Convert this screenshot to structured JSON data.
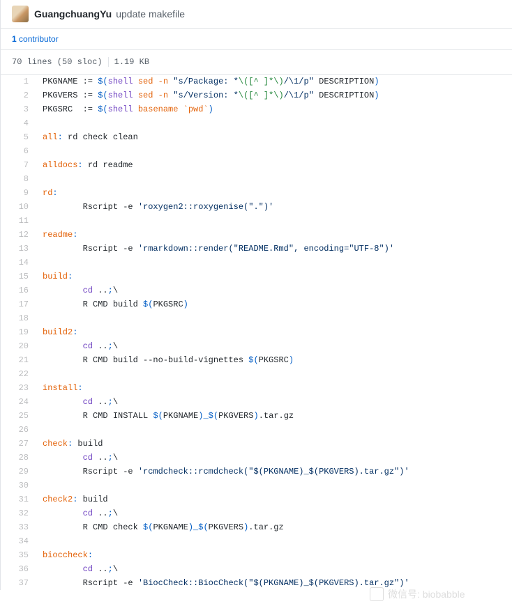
{
  "commit": {
    "author": "GuangchuangYu",
    "message": "update makefile"
  },
  "contributors": {
    "count": "1",
    "label": "contributor"
  },
  "file_meta": {
    "lines": "70 lines (50 sloc)",
    "size": "1.19 KB"
  },
  "code": [
    {
      "n": "1",
      "t": [
        [
          "",
          "PKGNAME := "
        ],
        [
          "k2",
          "$("
        ],
        [
          "k1",
          "shell"
        ],
        [
          "",
          " "
        ],
        [
          "kf",
          "sed -n "
        ],
        [
          "s1",
          "\"s/Package: *"
        ],
        [
          "gr",
          "\\([^ ]*\\)"
        ],
        [
          "s1",
          "/\\1/p\""
        ],
        [
          "",
          " DESCRIPTION"
        ],
        [
          "k2",
          ")"
        ]
      ]
    },
    {
      "n": "2",
      "t": [
        [
          "",
          "PKGVERS := "
        ],
        [
          "k2",
          "$("
        ],
        [
          "k1",
          "shell"
        ],
        [
          "",
          " "
        ],
        [
          "kf",
          "sed -n "
        ],
        [
          "s1",
          "\"s/Version: *"
        ],
        [
          "gr",
          "\\([^ ]*\\)"
        ],
        [
          "s1",
          "/\\1/p\""
        ],
        [
          "",
          " DESCRIPTION"
        ],
        [
          "k2",
          ")"
        ]
      ]
    },
    {
      "n": "3",
      "t": [
        [
          "",
          "PKGSRC  := "
        ],
        [
          "k2",
          "$("
        ],
        [
          "k1",
          "shell"
        ],
        [
          "",
          " "
        ],
        [
          "kf",
          "basename `pwd`"
        ],
        [
          "k2",
          ")"
        ]
      ]
    },
    {
      "n": "4",
      "t": []
    },
    {
      "n": "5",
      "t": [
        [
          "tg",
          "all"
        ],
        [
          "k2",
          ":"
        ],
        [
          "",
          " rd check clean"
        ]
      ]
    },
    {
      "n": "6",
      "t": []
    },
    {
      "n": "7",
      "t": [
        [
          "tg",
          "alldocs"
        ],
        [
          "k2",
          ":"
        ],
        [
          "",
          " rd readme"
        ]
      ]
    },
    {
      "n": "8",
      "t": []
    },
    {
      "n": "9",
      "t": [
        [
          "tg",
          "rd"
        ],
        [
          "k2",
          ":"
        ]
      ]
    },
    {
      "n": "10",
      "t": [
        [
          "",
          "        Rscript -e "
        ],
        [
          "s1",
          "'roxygen2::roxygenise(\".\")'"
        ]
      ]
    },
    {
      "n": "11",
      "t": []
    },
    {
      "n": "12",
      "t": [
        [
          "tg",
          "readme"
        ],
        [
          "k2",
          ":"
        ]
      ]
    },
    {
      "n": "13",
      "t": [
        [
          "",
          "        Rscript -e "
        ],
        [
          "s1",
          "'rmarkdown::render(\"README.Rmd\", encoding=\"UTF-8\")'"
        ]
      ]
    },
    {
      "n": "14",
      "t": []
    },
    {
      "n": "15",
      "t": [
        [
          "tg",
          "build"
        ],
        [
          "k2",
          ":"
        ]
      ]
    },
    {
      "n": "16",
      "t": [
        [
          "",
          "        "
        ],
        [
          "k1",
          "cd"
        ],
        [
          "",
          " .."
        ],
        [
          "k2",
          ";"
        ],
        [
          "",
          "\\"
        ]
      ]
    },
    {
      "n": "17",
      "t": [
        [
          "",
          "        R CMD build "
        ],
        [
          "k2",
          "$("
        ],
        [
          "",
          "PKGSRC"
        ],
        [
          "k2",
          ")"
        ]
      ]
    },
    {
      "n": "18",
      "t": []
    },
    {
      "n": "19",
      "t": [
        [
          "tg",
          "build2"
        ],
        [
          "k2",
          ":"
        ]
      ]
    },
    {
      "n": "20",
      "t": [
        [
          "",
          "        "
        ],
        [
          "k1",
          "cd"
        ],
        [
          "",
          " .."
        ],
        [
          "k2",
          ";"
        ],
        [
          "",
          "\\"
        ]
      ]
    },
    {
      "n": "21",
      "t": [
        [
          "",
          "        R CMD build --no-build-vignettes "
        ],
        [
          "k2",
          "$("
        ],
        [
          "",
          "PKGSRC"
        ],
        [
          "k2",
          ")"
        ]
      ]
    },
    {
      "n": "22",
      "t": []
    },
    {
      "n": "23",
      "t": [
        [
          "tg",
          "install"
        ],
        [
          "k2",
          ":"
        ]
      ]
    },
    {
      "n": "24",
      "t": [
        [
          "",
          "        "
        ],
        [
          "k1",
          "cd"
        ],
        [
          "",
          " .."
        ],
        [
          "k2",
          ";"
        ],
        [
          "",
          "\\"
        ]
      ]
    },
    {
      "n": "25",
      "t": [
        [
          "",
          "        R CMD INSTALL "
        ],
        [
          "k2",
          "$("
        ],
        [
          "",
          "PKGNAME"
        ],
        [
          "k2",
          ")_$("
        ],
        [
          "",
          "PKGVERS"
        ],
        [
          "k2",
          ")"
        ],
        [
          "",
          ".tar.gz"
        ]
      ]
    },
    {
      "n": "26",
      "t": []
    },
    {
      "n": "27",
      "t": [
        [
          "tg",
          "check"
        ],
        [
          "k2",
          ":"
        ],
        [
          "",
          " build"
        ]
      ]
    },
    {
      "n": "28",
      "t": [
        [
          "",
          "        "
        ],
        [
          "k1",
          "cd"
        ],
        [
          "",
          " .."
        ],
        [
          "k2",
          ";"
        ],
        [
          "",
          "\\"
        ]
      ]
    },
    {
      "n": "29",
      "t": [
        [
          "",
          "        Rscript -e "
        ],
        [
          "s1",
          "'rcmdcheck::rcmdcheck(\"$(PKGNAME)_$(PKGVERS).tar.gz\")'"
        ]
      ]
    },
    {
      "n": "30",
      "t": []
    },
    {
      "n": "31",
      "t": [
        [
          "tg",
          "check2"
        ],
        [
          "k2",
          ":"
        ],
        [
          "",
          " build"
        ]
      ]
    },
    {
      "n": "32",
      "t": [
        [
          "",
          "        "
        ],
        [
          "k1",
          "cd"
        ],
        [
          "",
          " .."
        ],
        [
          "k2",
          ";"
        ],
        [
          "",
          "\\"
        ]
      ]
    },
    {
      "n": "33",
      "t": [
        [
          "",
          "        R CMD check "
        ],
        [
          "k2",
          "$("
        ],
        [
          "",
          "PKGNAME"
        ],
        [
          "k2",
          ")_$("
        ],
        [
          "",
          "PKGVERS"
        ],
        [
          "k2",
          ")"
        ],
        [
          "",
          ".tar.gz"
        ]
      ]
    },
    {
      "n": "34",
      "t": []
    },
    {
      "n": "35",
      "t": [
        [
          "tg",
          "bioccheck"
        ],
        [
          "k2",
          ":"
        ]
      ]
    },
    {
      "n": "36",
      "t": [
        [
          "",
          "        "
        ],
        [
          "k1",
          "cd"
        ],
        [
          "",
          " .."
        ],
        [
          "k2",
          ";"
        ],
        [
          "",
          "\\"
        ]
      ]
    },
    {
      "n": "37",
      "t": [
        [
          "",
          "        Rscript -e "
        ],
        [
          "s1",
          "'BiocCheck::BiocCheck(\"$(PKGNAME)_$(PKGVERS).tar.gz\")'"
        ]
      ]
    }
  ],
  "watermark": "微信号: biobabble"
}
